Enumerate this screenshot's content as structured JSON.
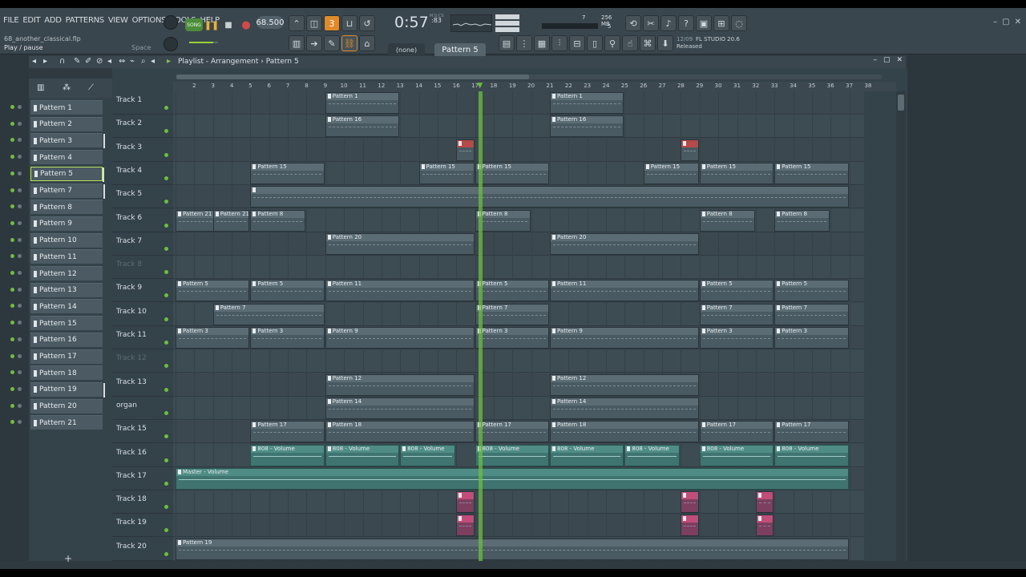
{
  "menu": [
    "FILE",
    "EDIT",
    "ADD",
    "PATTERNS",
    "VIEW",
    "OPTIONS",
    "TOOLS",
    "HELP"
  ],
  "file_title": "68_another_classical.flp",
  "hint": "Play / pause",
  "hint_key": "Space",
  "transport": {
    "song_label": "SONG",
    "play_icon": "❚❚",
    "stop_icon": "■",
    "record_icon": "●",
    "tempo": "68.500"
  },
  "time": {
    "main": "0:57",
    "sub": ":83",
    "label": "M:S:CS"
  },
  "meter": {
    "value1": "7",
    "memory": "256 MB",
    "poly": "5"
  },
  "pattern_none": "(none)",
  "current_pattern": "Pattern 5",
  "news": {
    "date": "12/09",
    "title": "FL STUDIO 20.6",
    "sub": "Released"
  },
  "window_controls": [
    "–",
    "▢",
    "✕"
  ],
  "playlist": {
    "title": "Playlist - Arrangement",
    "separator": "›",
    "pattern": "Pattern 5",
    "close_controls": [
      "–",
      "▢",
      "✕"
    ]
  },
  "browser_patterns": [
    "Pattern 1",
    "Pattern 2",
    "Pattern 3",
    "Pattern 4",
    "Pattern 5",
    "Pattern 7",
    "Pattern 8",
    "Pattern 9",
    "Pattern 10",
    "Pattern 11",
    "Pattern 12",
    "Pattern 13",
    "Pattern 14",
    "Pattern 15",
    "Pattern 16",
    "Pattern 17",
    "Pattern 18",
    "Pattern 19",
    "Pattern 20",
    "Pattern 21"
  ],
  "browser_add": "+",
  "ruler": [
    "2",
    "3",
    "4",
    "5",
    "6",
    "7",
    "8",
    "9",
    "10",
    "11",
    "12",
    "13",
    "14",
    "15",
    "16",
    "17",
    "18",
    "19",
    "20",
    "21",
    "22",
    "23",
    "24",
    "25",
    "26",
    "27",
    "28",
    "29",
    "30",
    "31",
    "32",
    "33",
    "34",
    "35",
    "36",
    "37",
    "38"
  ],
  "tracks": [
    {
      "name": "Track 1",
      "dim": false
    },
    {
      "name": "Track 2",
      "dim": false
    },
    {
      "name": "Track 3",
      "dim": false
    },
    {
      "name": "Track 4",
      "dim": false
    },
    {
      "name": "Track 5",
      "dim": false
    },
    {
      "name": "Track 6",
      "dim": false
    },
    {
      "name": "Track 7",
      "dim": false
    },
    {
      "name": "Track 8",
      "dim": true
    },
    {
      "name": "Track 9",
      "dim": false
    },
    {
      "name": "Track 10",
      "dim": false
    },
    {
      "name": "Track 11",
      "dim": false
    },
    {
      "name": "Track 12",
      "dim": true
    },
    {
      "name": "Track 13",
      "dim": false
    },
    {
      "name": "organ",
      "dim": false
    },
    {
      "name": "Track 15",
      "dim": false
    },
    {
      "name": "Track 16",
      "dim": false
    },
    {
      "name": "Track 17",
      "dim": false
    },
    {
      "name": "Track 18",
      "dim": false
    },
    {
      "name": "Track 19",
      "dim": false
    },
    {
      "name": "Track 20",
      "dim": false
    }
  ],
  "clips": [
    {
      "track": 0,
      "start": 9,
      "len": 4,
      "label": "Pattern 1"
    },
    {
      "track": 0,
      "start": 21,
      "len": 4,
      "label": "Pattern 1"
    },
    {
      "track": 1,
      "start": 9,
      "len": 4,
      "label": "Pattern 16"
    },
    {
      "track": 1,
      "start": 21,
      "len": 4,
      "label": "Pattern 16"
    },
    {
      "track": 2,
      "start": 16,
      "len": 1,
      "label": "",
      "kind": "red"
    },
    {
      "track": 2,
      "start": 28,
      "len": 1,
      "label": "",
      "kind": "red"
    },
    {
      "track": 3,
      "start": 5,
      "len": 4,
      "label": "Pattern 15"
    },
    {
      "track": 3,
      "start": 14,
      "len": 3,
      "label": "Pattern 15"
    },
    {
      "track": 3,
      "start": 17,
      "len": 4,
      "label": "Pattern 15"
    },
    {
      "track": 3,
      "start": 26,
      "len": 3,
      "label": "Pattern 15"
    },
    {
      "track": 3,
      "start": 29,
      "len": 4,
      "label": "Pattern 15"
    },
    {
      "track": 3,
      "start": 33,
      "len": 4,
      "label": "Pattern 15"
    },
    {
      "track": 4,
      "start": 5,
      "len": 32,
      "label": ""
    },
    {
      "track": 5,
      "start": 1,
      "len": 3,
      "label": "Pattern 21"
    },
    {
      "track": 5,
      "start": 3,
      "len": 2,
      "label": "Pattern 21"
    },
    {
      "track": 5,
      "start": 5,
      "len": 3,
      "label": "Pattern 8"
    },
    {
      "track": 5,
      "start": 17,
      "len": 3,
      "label": "Pattern 8"
    },
    {
      "track": 5,
      "start": 29,
      "len": 3,
      "label": "Pattern 8"
    },
    {
      "track": 5,
      "start": 33,
      "len": 3,
      "label": "Pattern 8"
    },
    {
      "track": 6,
      "start": 9,
      "len": 8,
      "label": "Pattern 20"
    },
    {
      "track": 6,
      "start": 21,
      "len": 8,
      "label": "Pattern 20"
    },
    {
      "track": 8,
      "start": 1,
      "len": 4,
      "label": "Pattern 5"
    },
    {
      "track": 8,
      "start": 5,
      "len": 4,
      "label": "Pattern 5"
    },
    {
      "track": 8,
      "start": 9,
      "len": 8,
      "label": "Pattern 11"
    },
    {
      "track": 8,
      "start": 17,
      "len": 4,
      "label": "Pattern 5"
    },
    {
      "track": 8,
      "start": 21,
      "len": 8,
      "label": "Pattern 11"
    },
    {
      "track": 8,
      "start": 29,
      "len": 4,
      "label": "Pattern 5"
    },
    {
      "track": 8,
      "start": 33,
      "len": 4,
      "label": "Pattern 5"
    },
    {
      "track": 9,
      "start": 3,
      "len": 6,
      "label": "Pattern 7"
    },
    {
      "track": 9,
      "start": 17,
      "len": 4,
      "label": "Pattern 7"
    },
    {
      "track": 9,
      "start": 29,
      "len": 4,
      "label": "Pattern 7"
    },
    {
      "track": 9,
      "start": 33,
      "len": 4,
      "label": "Pattern 7"
    },
    {
      "track": 10,
      "start": 1,
      "len": 4,
      "label": "Pattern 3"
    },
    {
      "track": 10,
      "start": 5,
      "len": 4,
      "label": "Pattern 3"
    },
    {
      "track": 10,
      "start": 9,
      "len": 8,
      "label": "Pattern 9"
    },
    {
      "track": 10,
      "start": 17,
      "len": 4,
      "label": "Pattern 3"
    },
    {
      "track": 10,
      "start": 21,
      "len": 8,
      "label": "Pattern 9"
    },
    {
      "track": 10,
      "start": 29,
      "len": 4,
      "label": "Pattern 3"
    },
    {
      "track": 10,
      "start": 33,
      "len": 4,
      "label": "Pattern 3"
    },
    {
      "track": 12,
      "start": 9,
      "len": 8,
      "label": "Pattern 12"
    },
    {
      "track": 12,
      "start": 21,
      "len": 8,
      "label": "Pattern 12"
    },
    {
      "track": 13,
      "start": 9,
      "len": 8,
      "label": "Pattern 14"
    },
    {
      "track": 13,
      "start": 21,
      "len": 8,
      "label": "Pattern 14"
    },
    {
      "track": 14,
      "start": 5,
      "len": 4,
      "label": "Pattern 17"
    },
    {
      "track": 14,
      "start": 9,
      "len": 8,
      "label": "Pattern 18"
    },
    {
      "track": 14,
      "start": 17,
      "len": 4,
      "label": "Pattern 17"
    },
    {
      "track": 14,
      "start": 21,
      "len": 8,
      "label": "Pattern 18"
    },
    {
      "track": 14,
      "start": 29,
      "len": 4,
      "label": "Pattern 17"
    },
    {
      "track": 14,
      "start": 33,
      "len": 4,
      "label": "Pattern 17"
    },
    {
      "track": 15,
      "start": 5,
      "len": 4,
      "label": "808 - Volume",
      "kind": "auto"
    },
    {
      "track": 15,
      "start": 9,
      "len": 4,
      "label": "808 - Volume",
      "kind": "auto"
    },
    {
      "track": 15,
      "start": 13,
      "len": 3,
      "label": "808 - Volume",
      "kind": "auto"
    },
    {
      "track": 15,
      "start": 17,
      "len": 4,
      "label": "808 - Volume",
      "kind": "auto"
    },
    {
      "track": 15,
      "start": 21,
      "len": 4,
      "label": "808 - Volume",
      "kind": "auto"
    },
    {
      "track": 15,
      "start": 25,
      "len": 3,
      "label": "808 - Volume",
      "kind": "auto"
    },
    {
      "track": 15,
      "start": 29,
      "len": 4,
      "label": "808 - Volume",
      "kind": "auto"
    },
    {
      "track": 15,
      "start": 33,
      "len": 4,
      "label": "808 - Volume",
      "kind": "auto"
    },
    {
      "track": 16,
      "start": 1,
      "len": 36,
      "label": "Master - Volume",
      "kind": "auto"
    },
    {
      "track": 17,
      "start": 16,
      "len": 1,
      "label": "",
      "kind": "pink"
    },
    {
      "track": 17,
      "start": 28,
      "len": 1,
      "label": "",
      "kind": "pink"
    },
    {
      "track": 17,
      "start": 32,
      "len": 1,
      "label": "",
      "kind": "pink"
    },
    {
      "track": 18,
      "start": 16,
      "len": 1,
      "label": "",
      "kind": "pink"
    },
    {
      "track": 18,
      "start": 28,
      "len": 1,
      "label": "",
      "kind": "pink"
    },
    {
      "track": 18,
      "start": 32,
      "len": 1,
      "label": "",
      "kind": "pink"
    },
    {
      "track": 19,
      "start": 1,
      "len": 36,
      "label": "Pattern 19"
    }
  ],
  "playhead_bar": 17.2,
  "colors": {
    "accent_green": "#6cbf3c",
    "accent_orange": "#e08a2a",
    "clip": "#4a5a63",
    "automation": "#3f7470"
  }
}
